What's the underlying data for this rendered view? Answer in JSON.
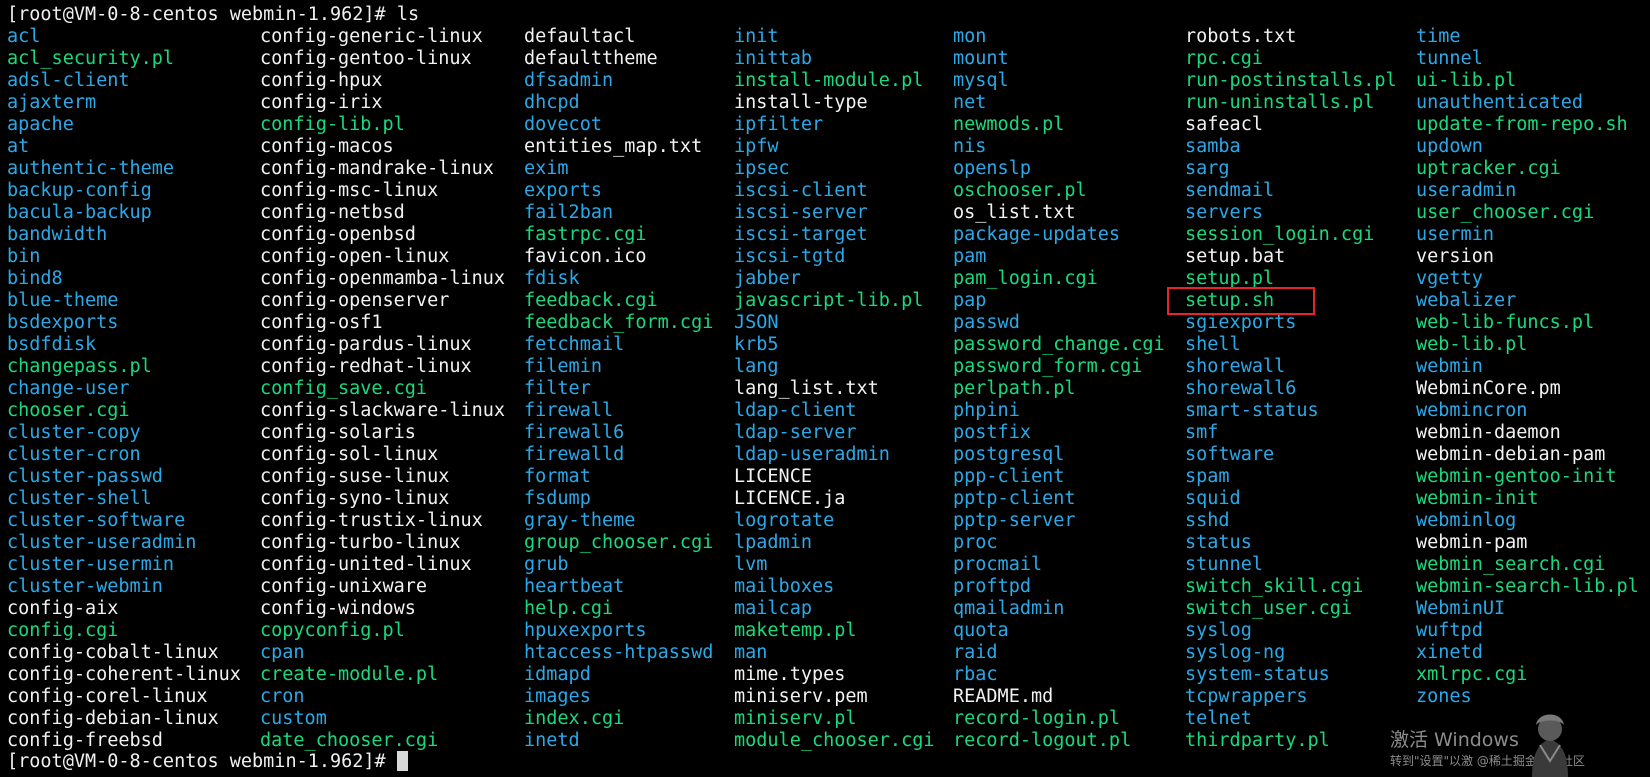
{
  "terminal": {
    "prompt": "[root@VM-0-8-centos webmin-1.962]# ",
    "command": "ls",
    "columns": [
      [
        {
          "name": "acl",
          "type": "dir"
        },
        {
          "name": "acl_security.pl",
          "type": "exe"
        },
        {
          "name": "adsl-client",
          "type": "dir"
        },
        {
          "name": "ajaxterm",
          "type": "dir"
        },
        {
          "name": "apache",
          "type": "dir"
        },
        {
          "name": "at",
          "type": "dir"
        },
        {
          "name": "authentic-theme",
          "type": "dir"
        },
        {
          "name": "backup-config",
          "type": "dir"
        },
        {
          "name": "bacula-backup",
          "type": "dir"
        },
        {
          "name": "bandwidth",
          "type": "dir"
        },
        {
          "name": "bin",
          "type": "dir"
        },
        {
          "name": "bind8",
          "type": "dir"
        },
        {
          "name": "blue-theme",
          "type": "dir"
        },
        {
          "name": "bsdexports",
          "type": "dir"
        },
        {
          "name": "bsdfdisk",
          "type": "dir"
        },
        {
          "name": "changepass.pl",
          "type": "exe"
        },
        {
          "name": "change-user",
          "type": "dir"
        },
        {
          "name": "chooser.cgi",
          "type": "exe"
        },
        {
          "name": "cluster-copy",
          "type": "dir"
        },
        {
          "name": "cluster-cron",
          "type": "dir"
        },
        {
          "name": "cluster-passwd",
          "type": "dir"
        },
        {
          "name": "cluster-shell",
          "type": "dir"
        },
        {
          "name": "cluster-software",
          "type": "dir"
        },
        {
          "name": "cluster-useradmin",
          "type": "dir"
        },
        {
          "name": "cluster-usermin",
          "type": "dir"
        },
        {
          "name": "cluster-webmin",
          "type": "dir"
        },
        {
          "name": "config-aix",
          "type": "file"
        },
        {
          "name": "config.cgi",
          "type": "exe"
        },
        {
          "name": "config-cobalt-linux",
          "type": "file"
        },
        {
          "name": "config-coherent-linux",
          "type": "file"
        },
        {
          "name": "config-corel-linux",
          "type": "file"
        },
        {
          "name": "config-debian-linux",
          "type": "file"
        },
        {
          "name": "config-freebsd",
          "type": "file"
        }
      ],
      [
        {
          "name": "config-generic-linux",
          "type": "file"
        },
        {
          "name": "config-gentoo-linux",
          "type": "file"
        },
        {
          "name": "config-hpux",
          "type": "file"
        },
        {
          "name": "config-irix",
          "type": "file"
        },
        {
          "name": "config-lib.pl",
          "type": "exe"
        },
        {
          "name": "config-macos",
          "type": "file"
        },
        {
          "name": "config-mandrake-linux",
          "type": "file"
        },
        {
          "name": "config-msc-linux",
          "type": "file"
        },
        {
          "name": "config-netbsd",
          "type": "file"
        },
        {
          "name": "config-openbsd",
          "type": "file"
        },
        {
          "name": "config-open-linux",
          "type": "file"
        },
        {
          "name": "config-openmamba-linux",
          "type": "file"
        },
        {
          "name": "config-openserver",
          "type": "file"
        },
        {
          "name": "config-osf1",
          "type": "file"
        },
        {
          "name": "config-pardus-linux",
          "type": "file"
        },
        {
          "name": "config-redhat-linux",
          "type": "file"
        },
        {
          "name": "config_save.cgi",
          "type": "exe"
        },
        {
          "name": "config-slackware-linux",
          "type": "file"
        },
        {
          "name": "config-solaris",
          "type": "file"
        },
        {
          "name": "config-sol-linux",
          "type": "file"
        },
        {
          "name": "config-suse-linux",
          "type": "file"
        },
        {
          "name": "config-syno-linux",
          "type": "file"
        },
        {
          "name": "config-trustix-linux",
          "type": "file"
        },
        {
          "name": "config-turbo-linux",
          "type": "file"
        },
        {
          "name": "config-united-linux",
          "type": "file"
        },
        {
          "name": "config-unixware",
          "type": "file"
        },
        {
          "name": "config-windows",
          "type": "file"
        },
        {
          "name": "copyconfig.pl",
          "type": "exe"
        },
        {
          "name": "cpan",
          "type": "dir"
        },
        {
          "name": "create-module.pl",
          "type": "exe"
        },
        {
          "name": "cron",
          "type": "dir"
        },
        {
          "name": "custom",
          "type": "dir"
        },
        {
          "name": "date_chooser.cgi",
          "type": "exe"
        }
      ],
      [
        {
          "name": "defaultacl",
          "type": "file"
        },
        {
          "name": "defaulttheme",
          "type": "file"
        },
        {
          "name": "dfsadmin",
          "type": "dir"
        },
        {
          "name": "dhcpd",
          "type": "dir"
        },
        {
          "name": "dovecot",
          "type": "dir"
        },
        {
          "name": "entities_map.txt",
          "type": "file"
        },
        {
          "name": "exim",
          "type": "dir"
        },
        {
          "name": "exports",
          "type": "dir"
        },
        {
          "name": "fail2ban",
          "type": "dir"
        },
        {
          "name": "fastrpc.cgi",
          "type": "exe"
        },
        {
          "name": "favicon.ico",
          "type": "file"
        },
        {
          "name": "fdisk",
          "type": "dir"
        },
        {
          "name": "feedback.cgi",
          "type": "exe"
        },
        {
          "name": "feedback_form.cgi",
          "type": "exe"
        },
        {
          "name": "fetchmail",
          "type": "dir"
        },
        {
          "name": "filemin",
          "type": "dir"
        },
        {
          "name": "filter",
          "type": "dir"
        },
        {
          "name": "firewall",
          "type": "dir"
        },
        {
          "name": "firewall6",
          "type": "dir"
        },
        {
          "name": "firewalld",
          "type": "dir"
        },
        {
          "name": "format",
          "type": "dir"
        },
        {
          "name": "fsdump",
          "type": "dir"
        },
        {
          "name": "gray-theme",
          "type": "dir"
        },
        {
          "name": "group_chooser.cgi",
          "type": "exe"
        },
        {
          "name": "grub",
          "type": "dir"
        },
        {
          "name": "heartbeat",
          "type": "dir"
        },
        {
          "name": "help.cgi",
          "type": "exe"
        },
        {
          "name": "hpuxexports",
          "type": "dir"
        },
        {
          "name": "htaccess-htpasswd",
          "type": "dir"
        },
        {
          "name": "idmapd",
          "type": "dir"
        },
        {
          "name": "images",
          "type": "dir"
        },
        {
          "name": "index.cgi",
          "type": "exe"
        },
        {
          "name": "inetd",
          "type": "dir"
        }
      ],
      [
        {
          "name": "init",
          "type": "dir"
        },
        {
          "name": "inittab",
          "type": "dir"
        },
        {
          "name": "install-module.pl",
          "type": "exe"
        },
        {
          "name": "install-type",
          "type": "file"
        },
        {
          "name": "ipfilter",
          "type": "dir"
        },
        {
          "name": "ipfw",
          "type": "dir"
        },
        {
          "name": "ipsec",
          "type": "dir"
        },
        {
          "name": "iscsi-client",
          "type": "dir"
        },
        {
          "name": "iscsi-server",
          "type": "dir"
        },
        {
          "name": "iscsi-target",
          "type": "dir"
        },
        {
          "name": "iscsi-tgtd",
          "type": "dir"
        },
        {
          "name": "jabber",
          "type": "dir"
        },
        {
          "name": "javascript-lib.pl",
          "type": "exe"
        },
        {
          "name": "JSON",
          "type": "dir"
        },
        {
          "name": "krb5",
          "type": "dir"
        },
        {
          "name": "lang",
          "type": "dir"
        },
        {
          "name": "lang_list.txt",
          "type": "file"
        },
        {
          "name": "ldap-client",
          "type": "dir"
        },
        {
          "name": "ldap-server",
          "type": "dir"
        },
        {
          "name": "ldap-useradmin",
          "type": "dir"
        },
        {
          "name": "LICENCE",
          "type": "file"
        },
        {
          "name": "LICENCE.ja",
          "type": "file"
        },
        {
          "name": "logrotate",
          "type": "dir"
        },
        {
          "name": "lpadmin",
          "type": "dir"
        },
        {
          "name": "lvm",
          "type": "dir"
        },
        {
          "name": "mailboxes",
          "type": "dir"
        },
        {
          "name": "mailcap",
          "type": "dir"
        },
        {
          "name": "maketemp.pl",
          "type": "exe"
        },
        {
          "name": "man",
          "type": "dir"
        },
        {
          "name": "mime.types",
          "type": "file"
        },
        {
          "name": "miniserv.pem",
          "type": "file"
        },
        {
          "name": "miniserv.pl",
          "type": "exe"
        },
        {
          "name": "module_chooser.cgi",
          "type": "exe"
        }
      ],
      [
        {
          "name": "mon",
          "type": "dir"
        },
        {
          "name": "mount",
          "type": "dir"
        },
        {
          "name": "mysql",
          "type": "dir"
        },
        {
          "name": "net",
          "type": "dir"
        },
        {
          "name": "newmods.pl",
          "type": "exe"
        },
        {
          "name": "nis",
          "type": "dir"
        },
        {
          "name": "openslp",
          "type": "dir"
        },
        {
          "name": "oschooser.pl",
          "type": "exe"
        },
        {
          "name": "os_list.txt",
          "type": "file"
        },
        {
          "name": "package-updates",
          "type": "dir"
        },
        {
          "name": "pam",
          "type": "dir"
        },
        {
          "name": "pam_login.cgi",
          "type": "exe"
        },
        {
          "name": "pap",
          "type": "dir"
        },
        {
          "name": "passwd",
          "type": "dir"
        },
        {
          "name": "password_change.cgi",
          "type": "exe"
        },
        {
          "name": "password_form.cgi",
          "type": "exe"
        },
        {
          "name": "perlpath.pl",
          "type": "exe"
        },
        {
          "name": "phpini",
          "type": "dir"
        },
        {
          "name": "postfix",
          "type": "dir"
        },
        {
          "name": "postgresql",
          "type": "dir"
        },
        {
          "name": "ppp-client",
          "type": "dir"
        },
        {
          "name": "pptp-client",
          "type": "dir"
        },
        {
          "name": "pptp-server",
          "type": "dir"
        },
        {
          "name": "proc",
          "type": "dir"
        },
        {
          "name": "procmail",
          "type": "dir"
        },
        {
          "name": "proftpd",
          "type": "dir"
        },
        {
          "name": "qmailadmin",
          "type": "dir"
        },
        {
          "name": "quota",
          "type": "dir"
        },
        {
          "name": "raid",
          "type": "dir"
        },
        {
          "name": "rbac",
          "type": "dir"
        },
        {
          "name": "README.md",
          "type": "file"
        },
        {
          "name": "record-login.pl",
          "type": "exe"
        },
        {
          "name": "record-logout.pl",
          "type": "exe"
        }
      ],
      [
        {
          "name": "robots.txt",
          "type": "file"
        },
        {
          "name": "rpc.cgi",
          "type": "exe"
        },
        {
          "name": "run-postinstalls.pl",
          "type": "exe"
        },
        {
          "name": "run-uninstalls.pl",
          "type": "exe"
        },
        {
          "name": "safeacl",
          "type": "file"
        },
        {
          "name": "samba",
          "type": "dir"
        },
        {
          "name": "sarg",
          "type": "dir"
        },
        {
          "name": "sendmail",
          "type": "dir"
        },
        {
          "name": "servers",
          "type": "dir"
        },
        {
          "name": "session_login.cgi",
          "type": "exe"
        },
        {
          "name": "setup.bat",
          "type": "file"
        },
        {
          "name": "setup.pl",
          "type": "exe"
        },
        {
          "name": "setup.sh",
          "type": "exe"
        },
        {
          "name": "sgiexports",
          "type": "dir"
        },
        {
          "name": "shell",
          "type": "dir"
        },
        {
          "name": "shorewall",
          "type": "dir"
        },
        {
          "name": "shorewall6",
          "type": "dir"
        },
        {
          "name": "smart-status",
          "type": "dir"
        },
        {
          "name": "smf",
          "type": "dir"
        },
        {
          "name": "software",
          "type": "dir"
        },
        {
          "name": "spam",
          "type": "dir"
        },
        {
          "name": "squid",
          "type": "dir"
        },
        {
          "name": "sshd",
          "type": "dir"
        },
        {
          "name": "status",
          "type": "dir"
        },
        {
          "name": "stunnel",
          "type": "dir"
        },
        {
          "name": "switch_skill.cgi",
          "type": "exe"
        },
        {
          "name": "switch_user.cgi",
          "type": "exe"
        },
        {
          "name": "syslog",
          "type": "dir"
        },
        {
          "name": "syslog-ng",
          "type": "dir"
        },
        {
          "name": "system-status",
          "type": "dir"
        },
        {
          "name": "tcpwrappers",
          "type": "dir"
        },
        {
          "name": "telnet",
          "type": "dir"
        },
        {
          "name": "thirdparty.pl",
          "type": "exe"
        }
      ],
      [
        {
          "name": "time",
          "type": "dir"
        },
        {
          "name": "tunnel",
          "type": "dir"
        },
        {
          "name": "ui-lib.pl",
          "type": "exe"
        },
        {
          "name": "unauthenticated",
          "type": "dir"
        },
        {
          "name": "update-from-repo.sh",
          "type": "exe"
        },
        {
          "name": "updown",
          "type": "dir"
        },
        {
          "name": "uptracker.cgi",
          "type": "exe"
        },
        {
          "name": "useradmin",
          "type": "dir"
        },
        {
          "name": "user_chooser.cgi",
          "type": "exe"
        },
        {
          "name": "usermin",
          "type": "dir"
        },
        {
          "name": "version",
          "type": "file"
        },
        {
          "name": "vgetty",
          "type": "dir"
        },
        {
          "name": "webalizer",
          "type": "dir"
        },
        {
          "name": "web-lib-funcs.pl",
          "type": "exe"
        },
        {
          "name": "web-lib.pl",
          "type": "exe"
        },
        {
          "name": "webmin",
          "type": "dir"
        },
        {
          "name": "WebminCore.pm",
          "type": "file"
        },
        {
          "name": "webmincron",
          "type": "dir"
        },
        {
          "name": "webmin-daemon",
          "type": "file"
        },
        {
          "name": "webmin-debian-pam",
          "type": "file"
        },
        {
          "name": "webmin-gentoo-init",
          "type": "exe"
        },
        {
          "name": "webmin-init",
          "type": "exe"
        },
        {
          "name": "webminlog",
          "type": "dir"
        },
        {
          "name": "webmin-pam",
          "type": "file"
        },
        {
          "name": "webmin_search.cgi",
          "type": "exe"
        },
        {
          "name": "webmin-search-lib.pl",
          "type": "exe"
        },
        {
          "name": "WebminUI",
          "type": "dir"
        },
        {
          "name": "wuftpd",
          "type": "dir"
        },
        {
          "name": "xinetd",
          "type": "dir"
        },
        {
          "name": "xmlrpc.cgi",
          "type": "exe"
        },
        {
          "name": "zones",
          "type": "dir"
        }
      ]
    ],
    "highlighted_entry": "setup.sh"
  },
  "colors": {
    "background": "#000000",
    "directory": "#2aa9e8",
    "executable": "#19d97d",
    "regular_file": "#f2f2f2",
    "highlight_box": "#e8242b"
  },
  "overlay": {
    "activation_title": "激活 Windows",
    "activation_hint": "转到\"设置\"以激",
    "community_mark": "@稀土掘金技术社区"
  }
}
